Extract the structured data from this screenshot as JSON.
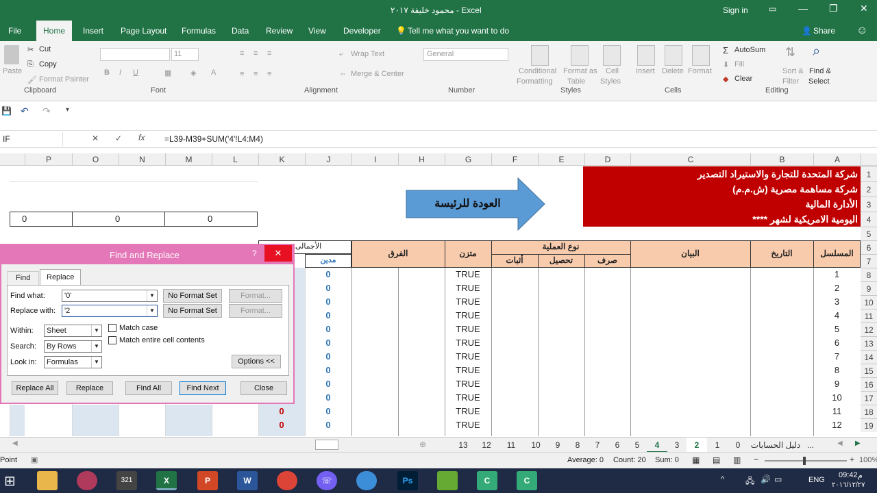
{
  "titlebar": {
    "title": "محمود خليفة ٢٠١٧ - Excel",
    "signin": "Sign in"
  },
  "tabs": [
    "File",
    "Home",
    "Insert",
    "Page Layout",
    "Formulas",
    "Data",
    "Review",
    "View",
    "Developer"
  ],
  "tellme": "Tell me what you want to do",
  "share": "Share",
  "ribbon": {
    "clipboard": {
      "paste": "Paste",
      "cut": "Cut",
      "copy": "Copy",
      "format_painter": "Format Painter",
      "label": "Clipboard"
    },
    "font": {
      "size": "11",
      "label": "Font"
    },
    "alignment": {
      "wrap": "Wrap Text",
      "merge": "Merge & Center",
      "label": "Alignment"
    },
    "number": {
      "format": "General",
      "label": "Number"
    },
    "styles": {
      "cond1": "Conditional",
      "cond2": "Formatting",
      "fmt1": "Format as",
      "fmt2": "Table",
      "cell1": "Cell",
      "cell2": "Styles",
      "label": "Styles"
    },
    "cells": {
      "insert": "Insert",
      "delete": "Delete",
      "format": "Format",
      "label": "Cells"
    },
    "editing": {
      "autosum": "AutoSum",
      "fill": "Fill",
      "clear": "Clear",
      "sort1": "Sort &",
      "sort2": "Filter",
      "find1": "Find &",
      "find2": "Select",
      "label": "Editing"
    }
  },
  "namebox": "IF",
  "formula": "=L39-M39+SUM('4'!L4:M4)",
  "columns": [
    "P",
    "O",
    "N",
    "M",
    "L",
    "K",
    "J",
    "I",
    "H",
    "G",
    "F",
    "E",
    "D",
    "C",
    "B",
    "A"
  ],
  "rows": [
    "1",
    "2",
    "3",
    "4",
    "5",
    "6",
    "7",
    "8",
    "9",
    "10",
    "11",
    "12",
    "13",
    "14",
    "15",
    "16",
    "17",
    "18",
    "19"
  ],
  "sheet": {
    "company1": "شركة المتحدة للتجارة والاستيراد التصدير",
    "company2": "شركة مساهمة مصرية (ش.م.م)",
    "dept": "الأدارة المالية",
    "daily": "اليومية الامريكية لشهر ****",
    "home_button": "العودة للرئيسة",
    "zero": "0",
    "h_serial": "المسلسل",
    "h_date": "التاريخ",
    "h_statement": "البيان",
    "h_optype": "نوع العملية",
    "h_expense": "صرف",
    "h_collect": "تحصيل",
    "h_proof": "أثبات",
    "h_balanced": "متزن",
    "h_diff": "الفرق",
    "h_total": "الأجمالى",
    "h_debit": "مدين",
    "true_val": "TRUE",
    "serials": [
      "1",
      "2",
      "3",
      "4",
      "5",
      "6",
      "7",
      "8",
      "9",
      "10",
      "11",
      "12"
    ]
  },
  "dialog": {
    "title": "Find and Replace",
    "help": "?",
    "tab_find": "Find",
    "tab_replace": "Replace",
    "find_label": "Find what:",
    "find_value": "'0'",
    "replace_label": "Replace with:",
    "replace_value": "'2",
    "no_format": "No Format Set",
    "format_btn": "Format...",
    "within_label": "Within:",
    "within_value": "Sheet",
    "search_label": "Search:",
    "search_value": "By Rows",
    "lookin_label": "Look in:",
    "lookin_value": "Formulas",
    "match_case": "Match case",
    "match_entire": "Match entire cell contents",
    "options": "Options <<",
    "replace_all": "Replace All",
    "replace": "Replace",
    "find_all": "Find All",
    "find_next": "Find Next",
    "close": "Close"
  },
  "sheet_tabs": [
    "13",
    "12",
    "11",
    "10",
    "9",
    "8",
    "7",
    "6",
    "5",
    "4",
    "3",
    "2",
    "1",
    "0",
    "دليل الحسابات",
    "..."
  ],
  "status": {
    "mode": "Point",
    "average": "Average: 0",
    "count": "Count: 20",
    "sum": "Sum: 0",
    "zoom": "100%"
  },
  "taskbar": {
    "lang": "ENG",
    "time": "09:42",
    "date": "٢٠١٦/١٢/٢٧",
    "ampm": "م"
  },
  "colors": {
    "excel_green": "#217346",
    "banner_red": "#c00000",
    "header_orange": "#f8cbad",
    "dialog_pink": "#e377b7",
    "arrow_blue": "#5b9bd5"
  }
}
